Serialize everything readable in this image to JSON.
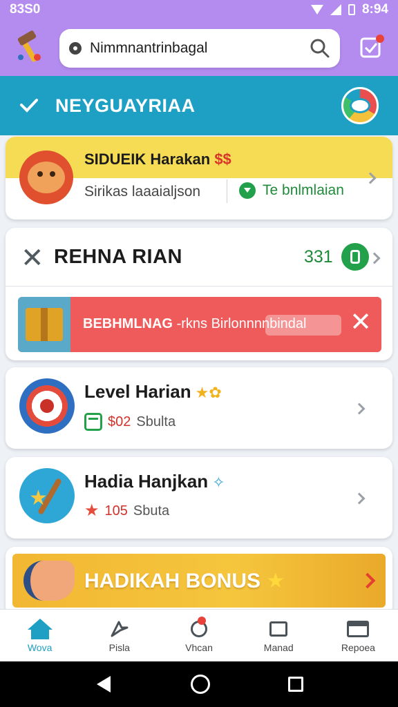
{
  "status_bar": {
    "time_left": "83S0",
    "time_right": "8:94"
  },
  "search": {
    "value": "Nimmnantrinbagal",
    "placeholder": "Nimmnantrinbagal"
  },
  "section": {
    "title": "NEYGUAYRIAA"
  },
  "promo_card": {
    "title": "SIDUEIK Harakan",
    "currency": "$$",
    "subtitle": "Sirikas laaaialjson",
    "status": "Te bnlmlaian"
  },
  "reward_card": {
    "title": "REHNA RIAN",
    "count": "331",
    "banner_text_bold": "BEBHMLNAG",
    "banner_text_light": "-rkns Birlonnnnbindal"
  },
  "list_items": [
    {
      "title": "Level Harian",
      "amount": "$02",
      "unit": "Sbulta"
    },
    {
      "title": "Hadia Hanjkan",
      "amount": "105",
      "unit": "Sbuta"
    }
  ],
  "bonus": {
    "label": "HADIKAH BONUS"
  },
  "bottom_nav": [
    {
      "label": "Wova",
      "active": true
    },
    {
      "label": "Pisla",
      "active": false
    },
    {
      "label": "Vhcan",
      "active": false
    },
    {
      "label": "Manad",
      "active": true
    },
    {
      "label": "Repoea",
      "active": false
    }
  ],
  "colors": {
    "top_bar": "#b48cf0",
    "section_header": "#1e9fc4",
    "promo_band": "#f6dc55",
    "banner_red": "#ef5b5b",
    "bonus_gold": "#f2b733",
    "accent_green": "#22a04a"
  }
}
